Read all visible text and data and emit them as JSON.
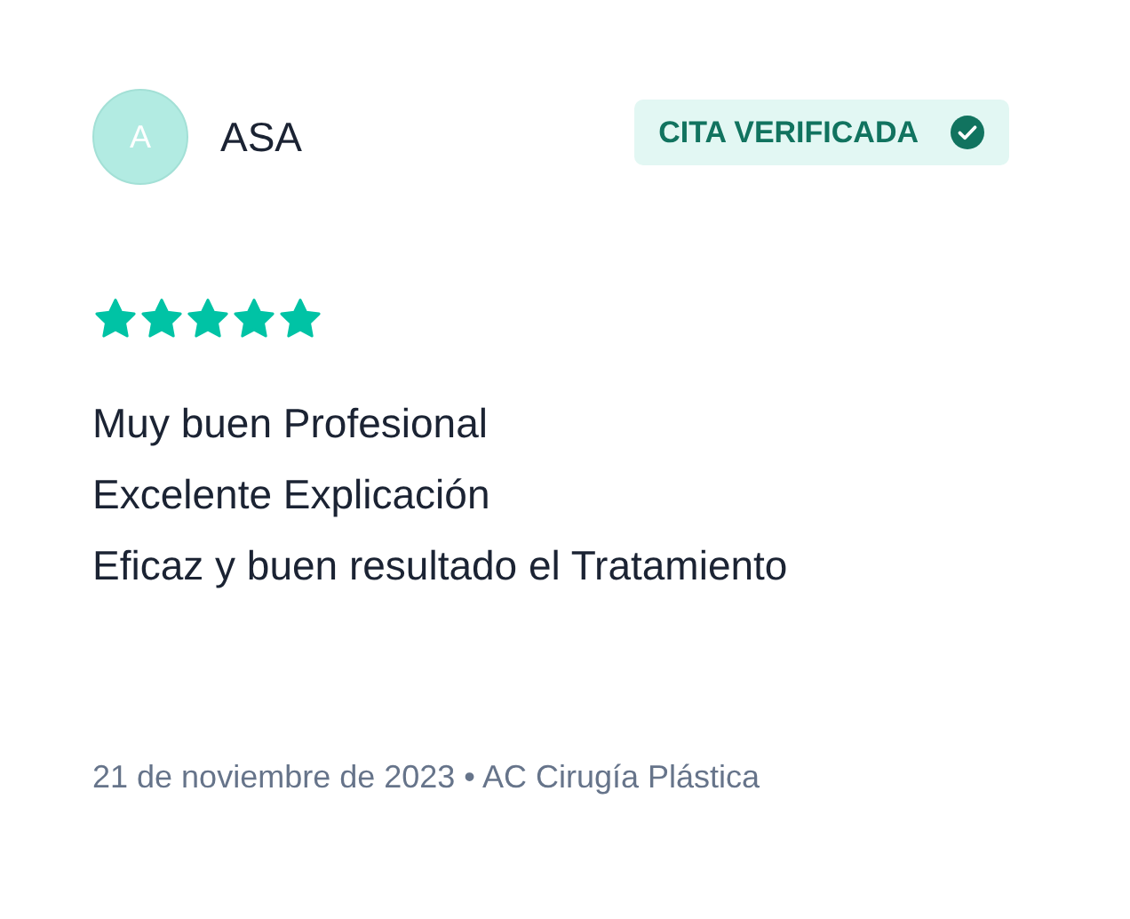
{
  "reviewer": {
    "initial": "A",
    "name": "ASA"
  },
  "badge": {
    "label": "CITA VERIFICADA",
    "verified": true
  },
  "rating": {
    "stars": 5
  },
  "review_lines": [
    "Muy buen Profesional",
    "Excelente Explicación",
    "Eficaz y buen resultado el Tratamiento"
  ],
  "footer": "21 de noviembre de 2023 • AC Cirugía Plástica"
}
